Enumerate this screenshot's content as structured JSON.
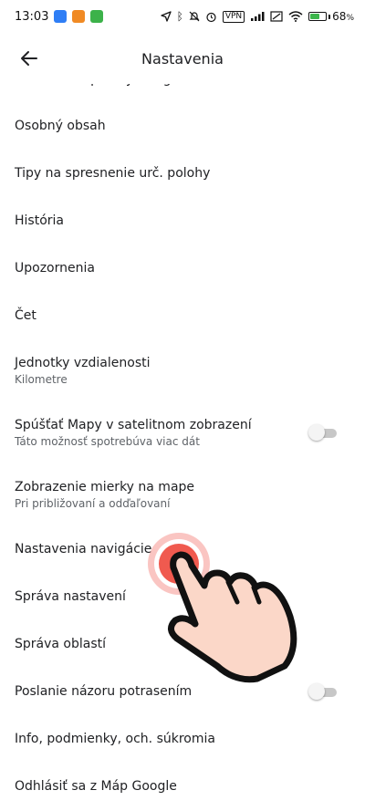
{
  "status_bar": {
    "time": "13:03",
    "vpn_label": "VPN",
    "battery_level": "68",
    "battery_unit": "%",
    "battery_fill_fraction": 0.68,
    "battery_color": "#3bb54a"
  },
  "app_bar": {
    "title": "Nastavenia",
    "back_icon": "arrow-left-icon"
  },
  "settings": {
    "partial_item": "Nastavenia polohy Google",
    "items": [
      {
        "label": "Osobný obsah"
      },
      {
        "label": "Tipy na spresnenie urč. polohy"
      },
      {
        "label": "História"
      },
      {
        "label": "Upozornenia"
      },
      {
        "label": "Čet"
      },
      {
        "label": "Jednotky vzdialenosti",
        "sub": "Kilometre"
      },
      {
        "label": "Spúšťať Mapy v satelitnom zobrazení",
        "sub": "Táto možnosť spotrebúva viac dát",
        "toggle": false
      },
      {
        "label": "Zobrazenie mierky na mape",
        "sub": "Pri približovaní a odďaľovaní"
      },
      {
        "label": "Nastavenia navigácie"
      },
      {
        "label": "Správa nastavení"
      },
      {
        "label": "Správa oblastí"
      },
      {
        "label": "Poslanie názoru potrasením",
        "toggle": false
      },
      {
        "label": "Info, podmienky, och. súkromia"
      },
      {
        "label": "Odhlásiť sa z Máp Google"
      }
    ]
  },
  "tap_indicator": {
    "icon": "tap-hand-icon",
    "ring_color": "#f05a4f"
  }
}
